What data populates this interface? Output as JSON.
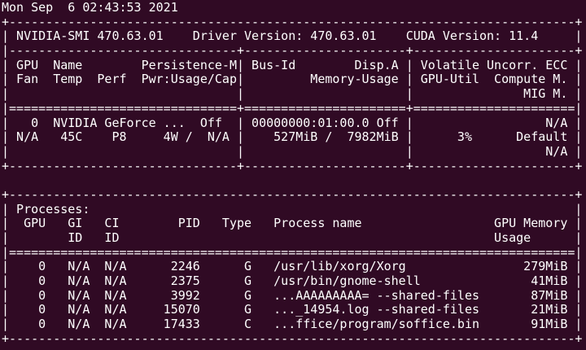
{
  "terminal": {
    "background_color": "#300a24",
    "text_color": "#ffffff",
    "timestamp": "Mon Sep  6 02:43:53 2021",
    "gpu_table": [
      "+-----------------------------------------------------------------------------+",
      "| NVIDIA-SMI 470.63.01    Driver Version: 470.63.01    CUDA Version: 11.4     |",
      "|-------------------------------+----------------------+----------------------+",
      "| GPU  Name        Persistence-M| Bus-Id        Disp.A | Volatile Uncorr. ECC |",
      "| Fan  Temp  Perf  Pwr:Usage/Cap|         Memory-Usage | GPU-Util  Compute M. |",
      "|                               |                      |               MIG M. |",
      "|===============================+======================+======================|",
      "|   0  NVIDIA GeForce ...  Off  | 00000000:01:00.0 Off |                  N/A |",
      "| N/A   45C    P8     4W /  N/A |    527MiB /  7982MiB |      3%      Default |",
      "|                               |                      |                  N/A |",
      "+-------------------------------+----------------------+----------------------+"
    ],
    "processes_table": [
      "+-----------------------------------------------------------------------------+",
      "| Processes:                                                                  |",
      "|  GPU   GI   CI        PID   Type   Process name                  GPU Memory |",
      "|        ID   ID                                                   Usage      |",
      "|=============================================================================|",
      "|    0   N/A  N/A      2246      G   /usr/lib/xorg/Xorg                279MiB |",
      "|    0   N/A  N/A      2375      G   /usr/bin/gnome-shell               41MiB |",
      "|    0   N/A  N/A      3992      G   ...AAAAAAAAA= --shared-files       87MiB |",
      "|    0   N/A  N/A     15070      G   ..._14954.log --shared-files       21MiB |",
      "|    0   N/A  N/A     17433      C   ...ffice/program/soffice.bin       91MiB |",
      "+-----------------------------------------------------------------------------+"
    ]
  }
}
